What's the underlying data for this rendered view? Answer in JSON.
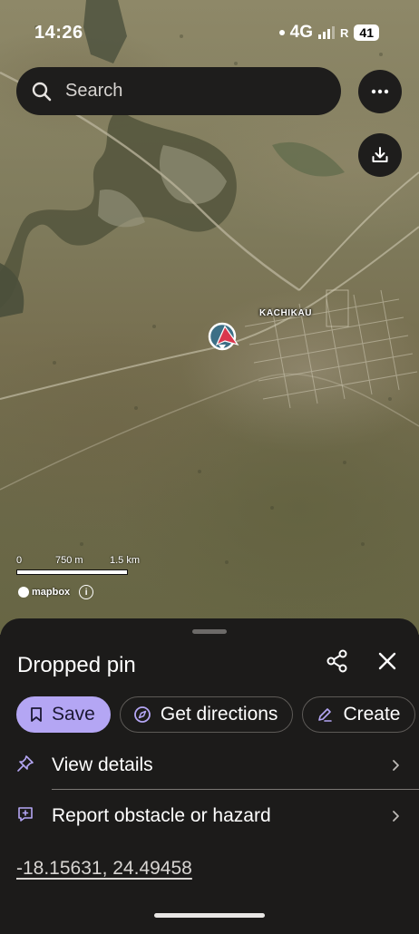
{
  "status_bar": {
    "time": "14:26",
    "network": "4G",
    "roaming": "R",
    "battery": "41"
  },
  "search": {
    "placeholder": "Search",
    "icon": "search-icon"
  },
  "map": {
    "place_label": "KACHIKAU",
    "scale_labels": [
      "0",
      "750 m",
      "1.5 km"
    ],
    "attribution": "mapbox",
    "more_icon": "more-horizontal-icon",
    "download_icon": "download-icon",
    "pin_icon": "dropped-pin-icon",
    "pin_color": "#d9364d",
    "pin_ring_color": "#3d6f86"
  },
  "sheet": {
    "title": "Dropped pin",
    "actions": [
      {
        "label": "Save",
        "icon": "bookmark-icon"
      },
      {
        "label": "Get directions",
        "icon": "compass-icon"
      },
      {
        "label": "Create",
        "icon": "pen-icon"
      }
    ],
    "rows": [
      {
        "label": "View details",
        "icon": "pushpin-icon"
      },
      {
        "label": "Report obstacle or hazard",
        "icon": "report-icon"
      }
    ],
    "coordinates": "-18.15631, 24.49458",
    "accent_color": "#b4a6f4"
  }
}
